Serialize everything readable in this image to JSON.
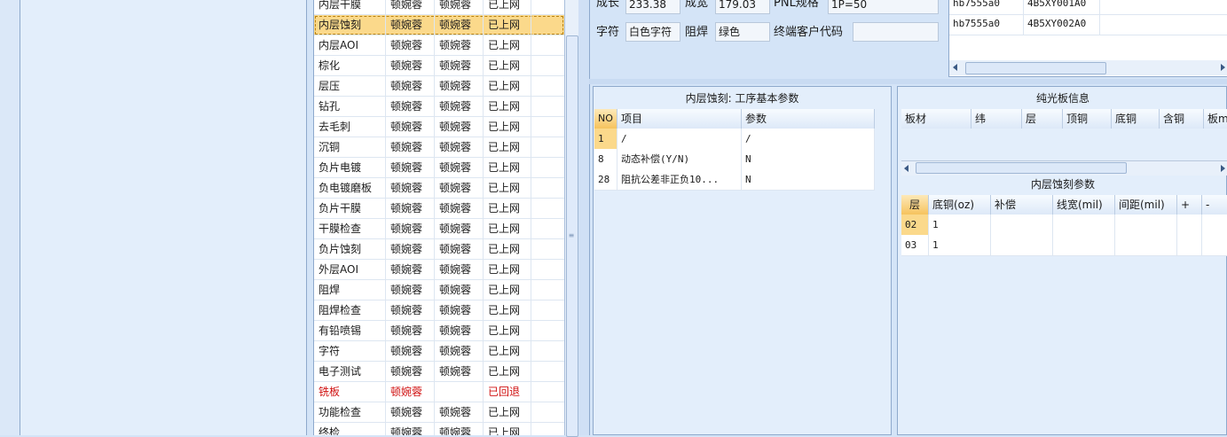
{
  "process_list": {
    "rows": [
      {
        "name": "内层干膜",
        "op1": "顿婉蓉",
        "op2": "顿婉蓉",
        "status": "已上网",
        "returned": false
      },
      {
        "name": "内层蚀刻",
        "op1": "顿婉蓉",
        "op2": "顿婉蓉",
        "status": "已上网",
        "returned": false
      },
      {
        "name": "内层AOI",
        "op1": "顿婉蓉",
        "op2": "顿婉蓉",
        "status": "已上网",
        "returned": false
      },
      {
        "name": "棕化",
        "op1": "顿婉蓉",
        "op2": "顿婉蓉",
        "status": "已上网",
        "returned": false
      },
      {
        "name": "层压",
        "op1": "顿婉蓉",
        "op2": "顿婉蓉",
        "status": "已上网",
        "returned": false
      },
      {
        "name": "钻孔",
        "op1": "顿婉蓉",
        "op2": "顿婉蓉",
        "status": "已上网",
        "returned": false
      },
      {
        "name": "去毛刺",
        "op1": "顿婉蓉",
        "op2": "顿婉蓉",
        "status": "已上网",
        "returned": false
      },
      {
        "name": "沉铜",
        "op1": "顿婉蓉",
        "op2": "顿婉蓉",
        "status": "已上网",
        "returned": false
      },
      {
        "name": "负片电镀",
        "op1": "顿婉蓉",
        "op2": "顿婉蓉",
        "status": "已上网",
        "returned": false
      },
      {
        "name": "负电镀磨板",
        "op1": "顿婉蓉",
        "op2": "顿婉蓉",
        "status": "已上网",
        "returned": false
      },
      {
        "name": "负片干膜",
        "op1": "顿婉蓉",
        "op2": "顿婉蓉",
        "status": "已上网",
        "returned": false
      },
      {
        "name": "干膜检查",
        "op1": "顿婉蓉",
        "op2": "顿婉蓉",
        "status": "已上网",
        "returned": false
      },
      {
        "name": "负片蚀刻",
        "op1": "顿婉蓉",
        "op2": "顿婉蓉",
        "status": "已上网",
        "returned": false
      },
      {
        "name": "外层AOI",
        "op1": "顿婉蓉",
        "op2": "顿婉蓉",
        "status": "已上网",
        "returned": false
      },
      {
        "name": "阻焊",
        "op1": "顿婉蓉",
        "op2": "顿婉蓉",
        "status": "已上网",
        "returned": false
      },
      {
        "name": "阻焊检查",
        "op1": "顿婉蓉",
        "op2": "顿婉蓉",
        "status": "已上网",
        "returned": false
      },
      {
        "name": "有铅喷锡",
        "op1": "顿婉蓉",
        "op2": "顿婉蓉",
        "status": "已上网",
        "returned": false
      },
      {
        "name": "字符",
        "op1": "顿婉蓉",
        "op2": "顿婉蓉",
        "status": "已上网",
        "returned": false
      },
      {
        "name": "电子测试",
        "op1": "顿婉蓉",
        "op2": "顿婉蓉",
        "status": "已上网",
        "returned": false
      },
      {
        "name": "铣板",
        "op1": "顿婉蓉",
        "op2": "",
        "status": "已回退",
        "returned": true
      },
      {
        "name": "功能检查",
        "op1": "顿婉蓉",
        "op2": "顿婉蓉",
        "status": "已上网",
        "returned": false
      },
      {
        "name": "终检",
        "op1": "顿婉蓉",
        "op2": "顿婉蓉",
        "status": "已上网",
        "returned": false
      }
    ],
    "selected_index": 1
  },
  "info": {
    "finished_length_label": "成长",
    "finished_length_value": "233.38",
    "finished_width_label": "成宽",
    "finished_width_value": "179.03",
    "pnl_spec_label": "PNL规格",
    "pnl_spec_value": "1P=50",
    "silkscreen_label": "字符",
    "silkscreen_value": "白色字符",
    "soldermask_label": "阻焊",
    "soldermask_value": "绿色",
    "customer_code_label": "终端客户代码",
    "customer_code_value": ""
  },
  "code_table": {
    "rows": [
      {
        "c1": "hb7555a0",
        "c2": "4B5XY001A0"
      },
      {
        "c1": "hb7555a0",
        "c2": "4B5XY002A0"
      }
    ]
  },
  "etch_panel": {
    "title": "内层蚀刻: 工序基本参数",
    "headers": {
      "no": "NO",
      "item": "项目",
      "param": "参数"
    },
    "rows": [
      {
        "no": "1",
        "item": "/",
        "param": "/"
      },
      {
        "no": "8",
        "item": "动态补偿(Y/N)",
        "param": "N"
      },
      {
        "no": "28",
        "item": "阻抗公差非正负10...",
        "param": "N"
      }
    ]
  },
  "bare_board_panel": {
    "title": "纯光板信息",
    "headers": [
      "板材",
      "纬",
      "层",
      "顶铜",
      "底铜",
      "含铜",
      "板mm"
    ]
  },
  "inner_etch_params": {
    "title": "内层蚀刻参数",
    "headers": [
      "层",
      "底铜(oz)",
      "补偿",
      "线宽(mil)",
      "间距(mil)",
      "+",
      "-"
    ],
    "rows": [
      {
        "layer": "02",
        "base_cu": "1"
      },
      {
        "layer": "03",
        "base_cu": "1"
      }
    ]
  },
  "colors": {
    "accent": "#fbd98b",
    "returned": "#d01010",
    "border": "#8ea9cc"
  }
}
